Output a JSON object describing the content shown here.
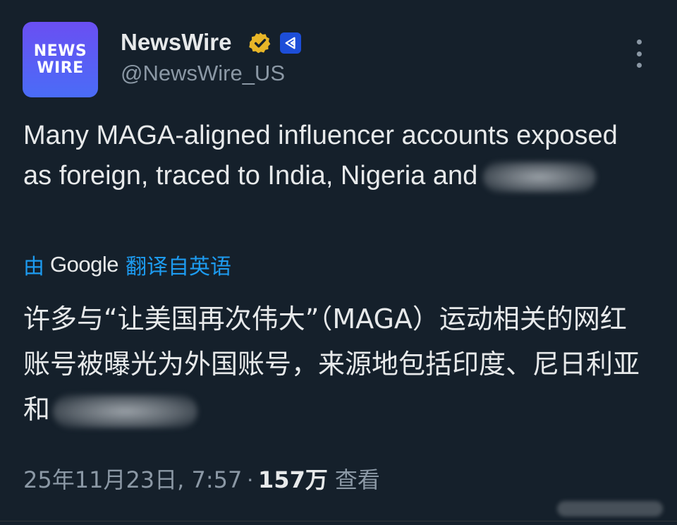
{
  "account": {
    "avatar_line1": "NEWS",
    "avatar_line2": "WIRE",
    "display_name": "NewsWire",
    "handle": "@NewsWire_US",
    "verified_icon": "gold-verified-badge-icon",
    "affiliate_icon": "affiliate-badge-icon"
  },
  "tweet": {
    "text": "Many MAGA-aligned influencer accounts exposed as foreign, traced to India, Nigeria and"
  },
  "translation": {
    "by": "由",
    "provider": "Google",
    "from": "翻译自英语",
    "text": "许多与“让美国再次伟大”（MAGA）运动相关的网红账号被曝光为外国账号，来源地包括印度、尼日利亚和"
  },
  "meta": {
    "date_time": "25年11月23日, 7:57",
    "separator": "·",
    "views_count": "157万",
    "views_label": "查看"
  },
  "colors": {
    "background": "#15202b",
    "text_primary": "#e7e9ea",
    "text_secondary": "#8b98a5",
    "link": "#1d9bf0",
    "verified_gold": "#e8b628",
    "affiliate_blue": "#1d4ed8"
  }
}
